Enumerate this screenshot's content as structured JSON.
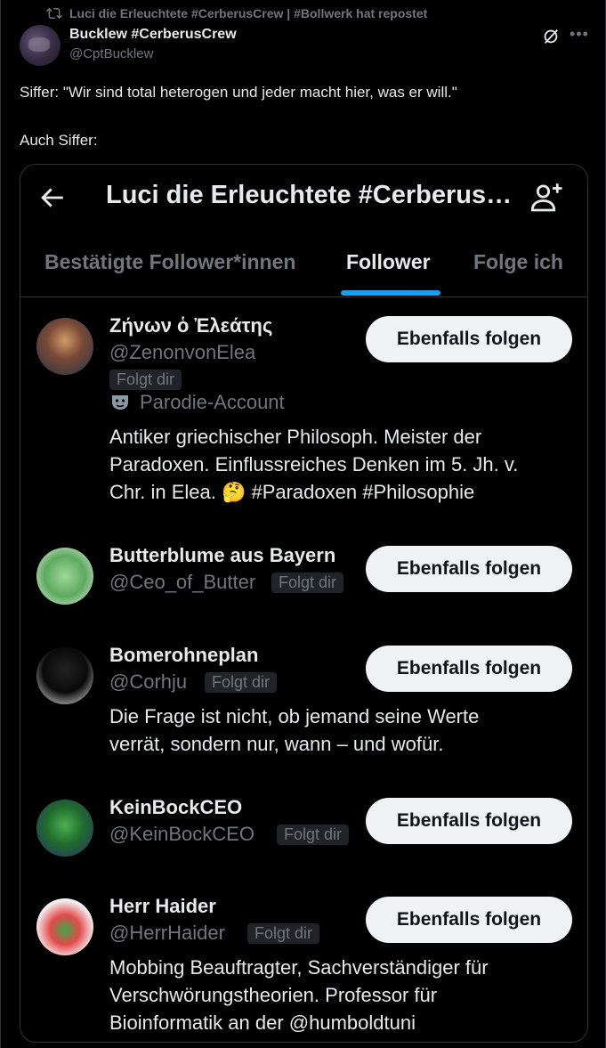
{
  "repost": {
    "text": "Luci die Erleuchtete #CerberusCrew | #Bollwerk hat repostet"
  },
  "author": {
    "name": "Bucklew #CerberusCrew",
    "handle": "@CptBucklew"
  },
  "tweet": {
    "line1": "Siffer: \"Wir sind total heterogen und jeder macht hier, was er will.\"",
    "line2": "Auch Siffer:"
  },
  "embed": {
    "title": "Luci die Erleuchtete #Cerberus…",
    "tabs": [
      "Bestätigte Follower*innen",
      "Follower",
      "Folge ich"
    ],
    "active_tab": "Follower",
    "follow_label": "Ebenfalls folgen",
    "followers": [
      {
        "name": "Ζήνων ὁ Ἐλεάτης",
        "handle": "@ZenonvonElea",
        "follows_you": "Folgt dir",
        "parody": "Parodie-Account",
        "bio": [
          "Antiker griechischer Philosoph. Meister der",
          "Paradoxen. Einflussreiches Denken im 5. Jh. v.",
          "Chr. in Elea. 🤔 #Paradoxen #Philosophie"
        ]
      },
      {
        "name": "Butterblume aus Bayern",
        "handle": "@Ceo_of_Butter",
        "follows_you": "Folgt dir"
      },
      {
        "name": "Bomerohneplan",
        "handle": "@Corhju",
        "follows_you": "Folgt dir",
        "bio": [
          "Die Frage ist nicht, ob jemand seine Werte",
          "verrät, sondern nur, wann – und wofür."
        ]
      },
      {
        "name": "KeinBockCEO",
        "handle": "@KeinBockCEO",
        "follows_you": "Folgt dir"
      },
      {
        "name": "Herr Haider",
        "handle": "@HerrHaider",
        "follows_you": "Folgt dir",
        "bio": [
          "Mobbing Beauftragter, Sachverständiger für",
          "Verschwörungstheorien. Professor für",
          "Bioinformatik an der @humboldtuni"
        ]
      }
    ]
  },
  "colors": {
    "background": "#000000",
    "accent": "#1d9bf0",
    "muted": "#71767b",
    "button": "#eff3f4"
  }
}
